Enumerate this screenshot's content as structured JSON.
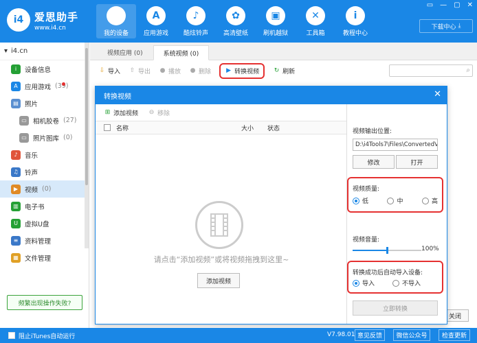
{
  "app": {
    "title": "爱思助手",
    "url": "www.i4.cn",
    "logo_text": "i4",
    "accent": "#1a87e6"
  },
  "nav": [
    {
      "label": "我的设备",
      "icon": "apple-icon",
      "glyph": "",
      "active": true
    },
    {
      "label": "应用游戏",
      "icon": "appstore-icon",
      "glyph": "A"
    },
    {
      "label": "酷炫铃声",
      "icon": "bell-icon",
      "glyph": "♪"
    },
    {
      "label": "高清壁纸",
      "icon": "flower-icon",
      "glyph": "✿"
    },
    {
      "label": "刷机越狱",
      "icon": "box-icon",
      "glyph": "▣"
    },
    {
      "label": "工具箱",
      "icon": "tools-icon",
      "glyph": "✕"
    },
    {
      "label": "教程中心",
      "icon": "info-icon",
      "glyph": "i"
    }
  ],
  "window_controls": [
    "▭",
    "—",
    "▢",
    "✕"
  ],
  "download_center": "下载中心",
  "device": {
    "name": "i4.cn"
  },
  "sidebar": {
    "items": [
      {
        "label": "设备信息",
        "icon": "info-icon",
        "color": "#25a035",
        "glyph": "i"
      },
      {
        "label": "应用游戏",
        "count": "(39)",
        "icon": "appstore-icon",
        "color": "#1a87e6",
        "glyph": "A",
        "badge": true
      },
      {
        "label": "照片",
        "icon": "photo-icon",
        "color": "#5a8fd0",
        "glyph": "▤"
      },
      {
        "label": "相机胶卷",
        "count": "(27)",
        "icon": "folder-icon",
        "color": "#999",
        "glyph": "▭",
        "sub": true
      },
      {
        "label": "照片图库",
        "count": "(0)",
        "icon": "folder-icon",
        "color": "#999",
        "glyph": "▭",
        "sub": true
      },
      {
        "label": "音乐",
        "icon": "music-icon",
        "color": "#e0553a",
        "glyph": "♪"
      },
      {
        "label": "铃声",
        "icon": "bell-icon",
        "color": "#3a78c8",
        "glyph": "♫"
      },
      {
        "label": "视频",
        "count": "(0)",
        "icon": "video-icon",
        "color": "#e08a25",
        "glyph": "▶",
        "active": true
      },
      {
        "label": "电子书",
        "icon": "book-icon",
        "color": "#25a035",
        "glyph": "▥"
      },
      {
        "label": "虚拟U盘",
        "icon": "usb-icon",
        "color": "#25a035",
        "glyph": "U"
      },
      {
        "label": "资料管理",
        "icon": "docs-icon",
        "color": "#3a78c8",
        "glyph": "≡"
      },
      {
        "label": "文件管理",
        "icon": "files-icon",
        "color": "#e0a025",
        "glyph": "▦"
      }
    ],
    "fail_button": "频繁出现操作失败?"
  },
  "tabs": [
    {
      "label": "视频应用 (0)",
      "active": false
    },
    {
      "label": "系统视频 (0)",
      "active": true
    }
  ],
  "toolbar": {
    "import": "导入",
    "export": "导出",
    "play": "播放",
    "delete": "删除",
    "convert": "转换视频",
    "refresh": "刷新"
  },
  "bottom_close": "关闭",
  "dialog": {
    "title": "转换视频",
    "add_video": "添加视频",
    "remove": "移除",
    "col_name": "名称",
    "col_size": "大小",
    "col_status": "状态",
    "empty_text": "请点击“添加视频”或将视频拖拽到这里~",
    "add_button": "添加视频",
    "output_label": "视频输出位置:",
    "output_path": "D:\\i4Tools7\\Files\\ConvertedVi",
    "modify": "修改",
    "open": "打开",
    "quality_label": "视频质量:",
    "quality_options": [
      "低",
      "中",
      "高"
    ],
    "quality_selected": 0,
    "volume_label": "视频音量:",
    "volume_value": "100%",
    "volume_fraction": 0.5,
    "auto_import_label": "转换成功后自动导入设备:",
    "import_options": [
      "导入",
      "不导入"
    ],
    "import_selected": 0,
    "convert_now": "立即转换"
  },
  "status": {
    "itunes": "阻止iTunes自动运行",
    "version": "V7.98.01",
    "feedback": "意见反馈",
    "wechat": "微信公众号",
    "update": "检查更新"
  }
}
